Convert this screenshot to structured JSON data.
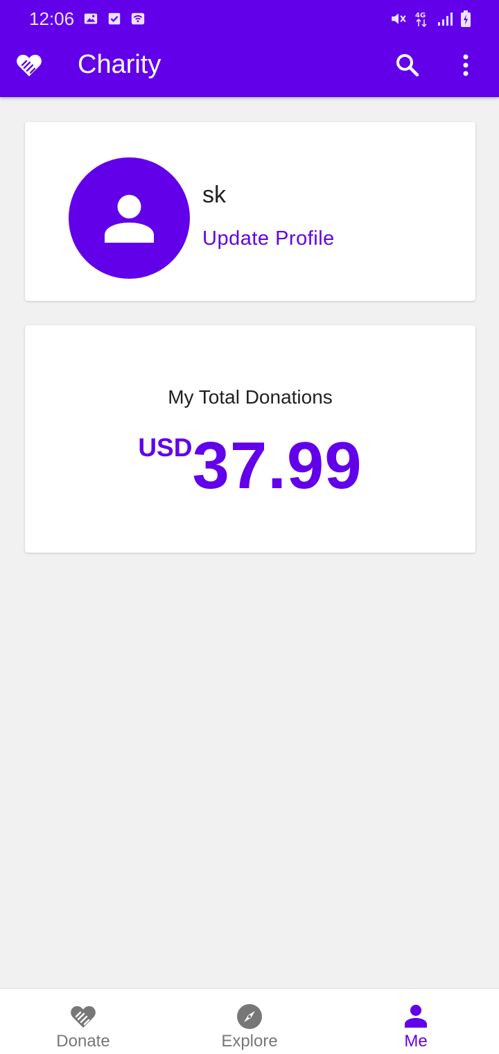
{
  "status_bar": {
    "time": "12:06",
    "icons": [
      "image-icon",
      "checkbox-icon",
      "wifi-icon",
      "mute-icon",
      "4g-icon",
      "signal-icon",
      "battery-icon"
    ]
  },
  "app_bar": {
    "title": "Charity",
    "logo_icon": "heart-handshake-icon",
    "actions": [
      "search-icon",
      "more-vert-icon"
    ]
  },
  "profile": {
    "name": "sk",
    "update_label": "Update Profile",
    "avatar_icon": "person-icon"
  },
  "donations": {
    "title": "My Total Donations",
    "currency": "USD",
    "amount": "37.99"
  },
  "bottom_nav": {
    "items": [
      {
        "label": "Donate",
        "icon": "heart-handshake-icon"
      },
      {
        "label": "Explore",
        "icon": "compass-icon"
      },
      {
        "label": "Me",
        "icon": "person-icon"
      }
    ],
    "active": "Me"
  },
  "colors": {
    "primary": "#6200ea",
    "background": "#f1f1f1",
    "inactive": "#777777"
  }
}
